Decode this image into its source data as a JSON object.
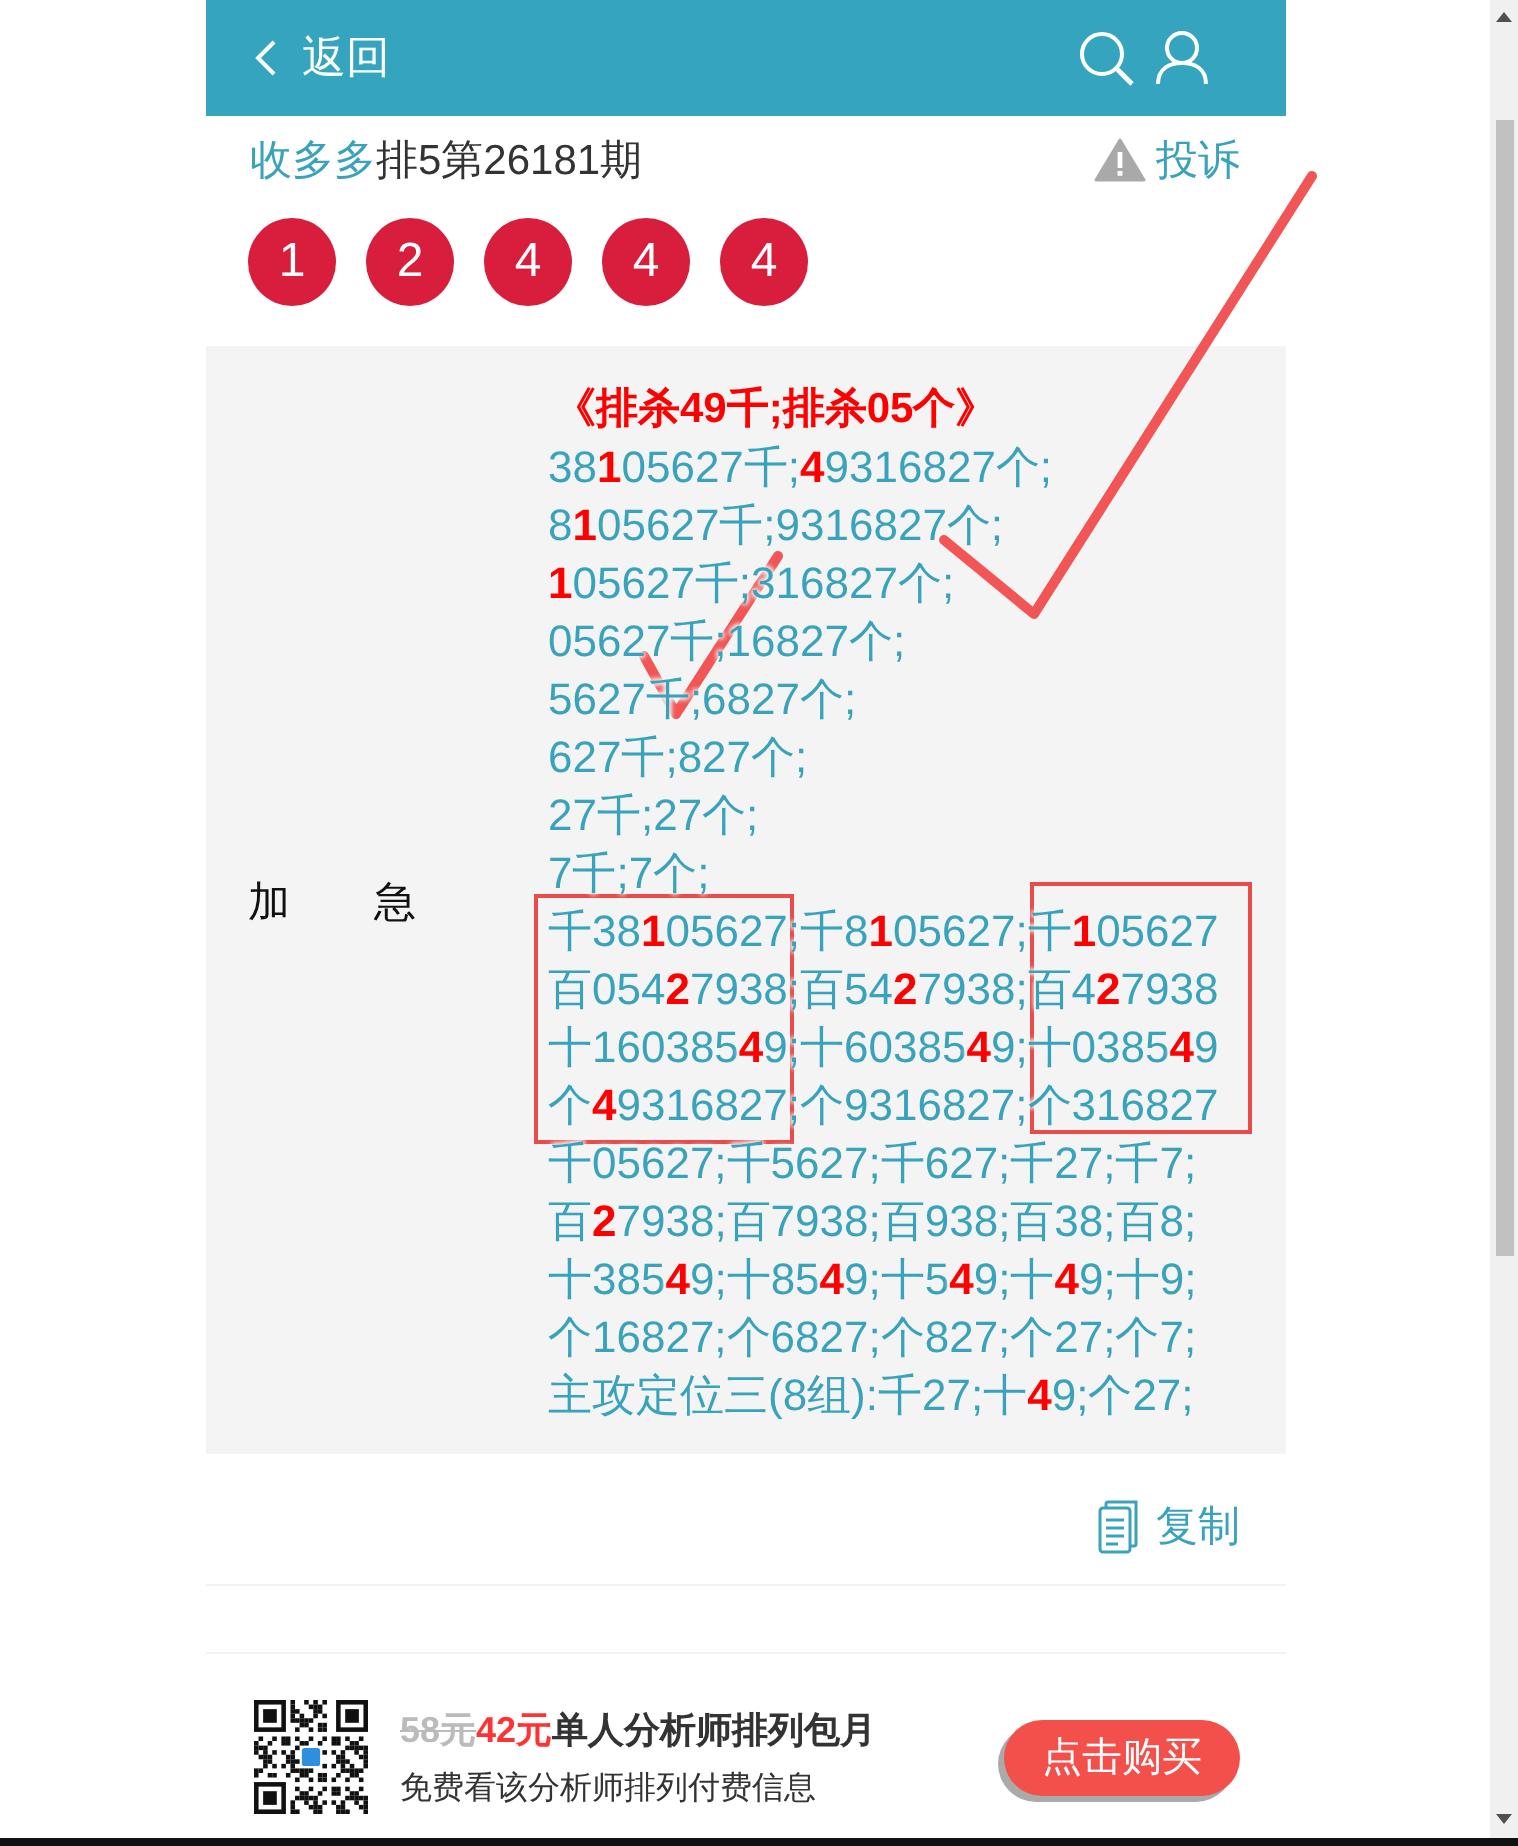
{
  "header": {
    "back_label": "返回"
  },
  "issue": {
    "author": "收多多",
    "title": "排5第26181期",
    "report_label": "投诉"
  },
  "balls": [
    "1",
    "2",
    "4",
    "4",
    "4"
  ],
  "forecast": {
    "label": "加　　急",
    "lines": [
      {
        "kind": "heading",
        "text": "《排杀49千;排杀05个》"
      },
      {
        "kind": "line",
        "text": "38**1**05627千;**4**9316827个;"
      },
      {
        "kind": "line",
        "text": "8**1**05627千;9316827个;"
      },
      {
        "kind": "line",
        "text": "**1**05627千;316827个;"
      },
      {
        "kind": "line",
        "text": "05627千;16827个;"
      },
      {
        "kind": "line",
        "text": "5627千;6827个;"
      },
      {
        "kind": "line",
        "text": "627千;827个;"
      },
      {
        "kind": "line",
        "text": "27千;27个;"
      },
      {
        "kind": "line",
        "text": "7千;7个;"
      },
      {
        "kind": "line",
        "text": "千38**1**05627;千8**1**05627;千**1**05627"
      },
      {
        "kind": "line",
        "text": "百054**2**7938;百54**2**7938;百4**2**7938"
      },
      {
        "kind": "line",
        "text": "十160385**4**9;十60385**4**9;十0385**4**9"
      },
      {
        "kind": "line",
        "text": "个**4**9316827;个9316827;个316827"
      },
      {
        "kind": "line",
        "text": "千05627;千5627;千627;千27;千7;"
      },
      {
        "kind": "line",
        "text": "百**2**7938;百7938;百938;百38;百8;"
      },
      {
        "kind": "line",
        "text": "十385**4**9;十85**4**9;十5**4**9;十**4**9;十9;"
      },
      {
        "kind": "line",
        "text": "个16827;个6827;个827;个27;个7;"
      },
      {
        "kind": "line",
        "text": "主攻定位三(8组):千27;十**4**9;个27;"
      }
    ]
  },
  "copy_button": {
    "label": "复制"
  },
  "promo": {
    "old_price": "58元",
    "price": "42元",
    "title": "单人分析师排列包月",
    "subtitle": "免费看该分析师排列付费信息",
    "button": "点击购买"
  },
  "annotations": [
    {
      "kind": "check"
    },
    {
      "kind": "check"
    },
    {
      "kind": "box"
    },
    {
      "kind": "box"
    }
  ]
}
